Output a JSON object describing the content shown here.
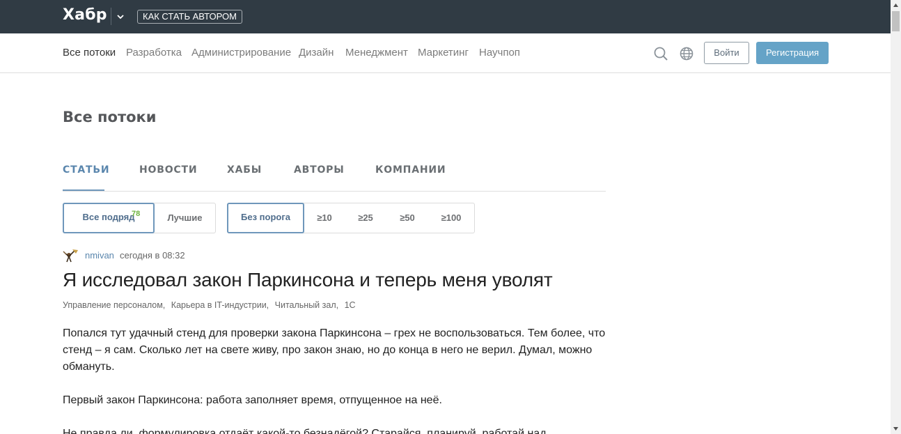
{
  "header": {
    "logo": "Хабр",
    "author_button": "КАК СТАТЬ АВТОРОМ"
  },
  "nav": {
    "items": [
      "Все потоки",
      "Разработка",
      "Администрирование",
      "Дизайн",
      "Менеджмент",
      "Маркетинг",
      "Научпоп"
    ],
    "login": "Войти",
    "register": "Регистрация"
  },
  "page": {
    "title": "Все потоки"
  },
  "tabs": [
    "СТАТЬИ",
    "НОВОСТИ",
    "ХАБЫ",
    "АВТОРЫ",
    "КОМПАНИИ"
  ],
  "filters": {
    "sort": [
      {
        "label": "Все подряд",
        "badge": "78"
      },
      {
        "label": "Лучшие"
      }
    ],
    "threshold": [
      "Без порога",
      "≥10",
      "≥25",
      "≥50",
      "≥100"
    ]
  },
  "article": {
    "author": "nmivan",
    "time": "сегодня в 08:32",
    "title": "Я исследовал закон Паркинсона и теперь меня уволят",
    "hubs": [
      "Управление персоналом,",
      "Карьера в IT-индустрии,",
      "Читальный зал,",
      "1С"
    ],
    "paragraphs": [
      "Попался тут удачный стенд для проверки закона Паркинсона – грех не воспользоваться. Тем более, что стенд – я сам. Сколько лет на свете живу, про закон знаю, но до конца в него не верил. Думал, можно обмануть.",
      "Первый закон Паркинсона: работа заполняет время, отпущенное на неё.",
      "Не правда ли, формулировка отдаёт какой-то безнадёгой? Старайся, планируй, работай над"
    ]
  },
  "icons": {
    "logo_chevron": "chevron-down-icon",
    "search": "search-icon",
    "language": "globe-icon"
  },
  "colors": {
    "header_bg": "#303b44",
    "accent": "#5a86ad",
    "register_bg": "#65a3c7",
    "badge": "#6eb33f"
  }
}
